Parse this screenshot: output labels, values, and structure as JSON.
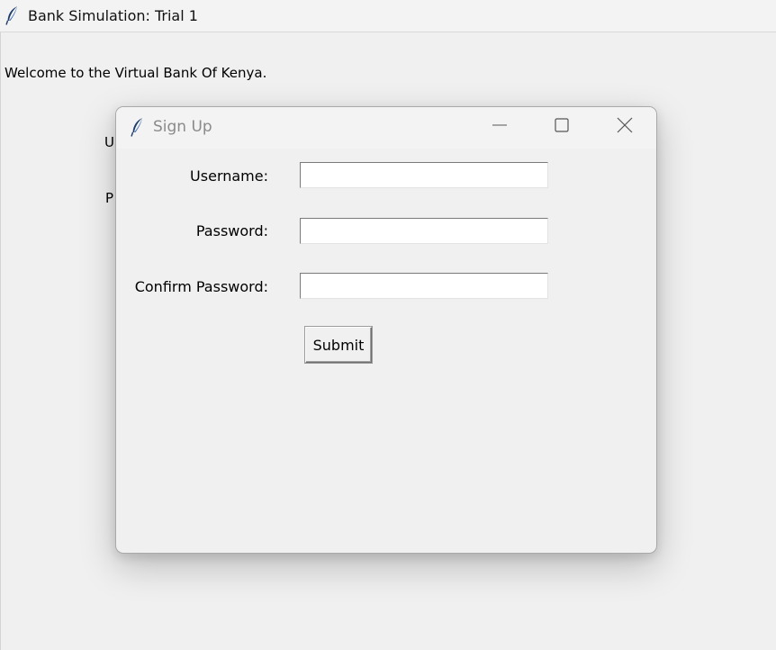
{
  "main_window": {
    "title": "Bank Simulation: Trial 1",
    "app_icon": "feather-icon",
    "welcome_text": "Welcome to the Virtual Bank Of Kenya.",
    "obscured_labels": [
      "U",
      "P"
    ]
  },
  "dialog": {
    "title": "Sign Up",
    "app_icon": "feather-icon",
    "controls": {
      "minimize_icon": "minimize-icon",
      "maximize_icon": "maximize-icon",
      "close_icon": "close-icon"
    },
    "fields": {
      "username": {
        "label": "Username:",
        "value": ""
      },
      "password": {
        "label": "Password:",
        "value": ""
      },
      "confirm_password": {
        "label": "Confirm Password:",
        "value": ""
      }
    },
    "submit_label": "Submit"
  },
  "colors": {
    "window_bg": "#f0f0f0",
    "titlebar_bg": "#f3f3f3",
    "dialog_title_text": "#8a8a8a",
    "entry_bg": "#ffffff"
  }
}
